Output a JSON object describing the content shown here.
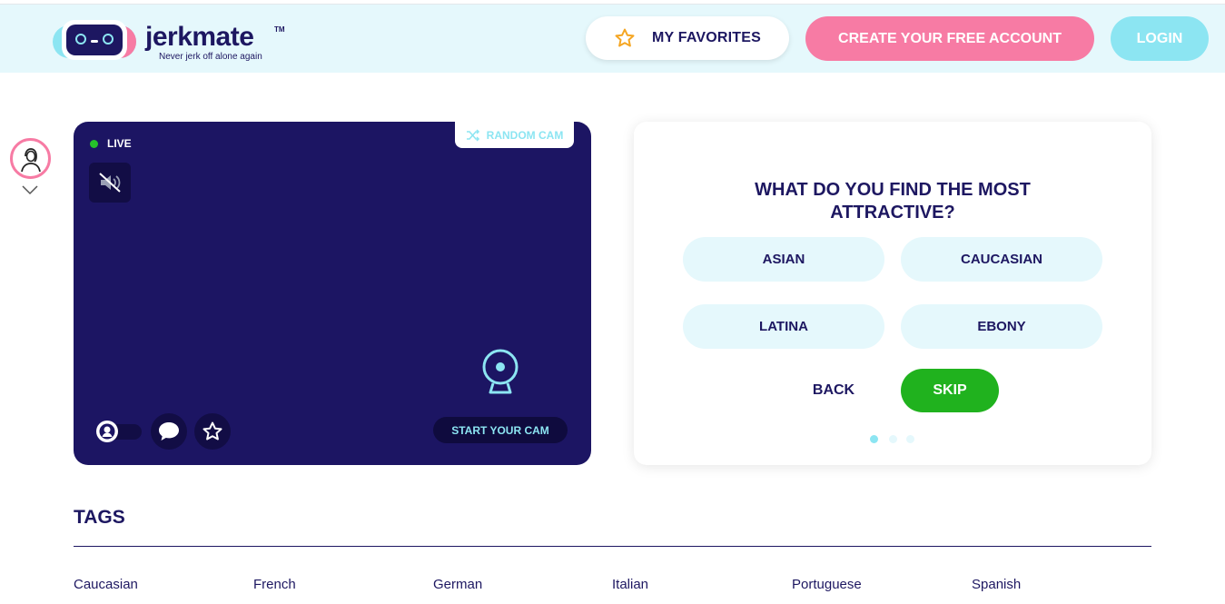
{
  "header": {
    "logo_text": "jerkmate",
    "logo_tm": "TM",
    "logo_tagline": "Never jerk off alone again",
    "favorites_label": "MY FAVORITES",
    "create_account_label": "CREATE YOUR FREE ACCOUNT",
    "login_label": "LOGIN"
  },
  "video": {
    "live_label": "LIVE",
    "random_cam_label": "RANDOM CAM",
    "start_cam_label": "START YOUR CAM"
  },
  "quiz": {
    "question": "WHAT DO YOU FIND THE MOST ATTRACTIVE?",
    "options": [
      "ASIAN",
      "CAUCASIAN",
      "LATINA",
      "EBONY"
    ],
    "back_label": "BACK",
    "skip_label": "SKIP",
    "steps_total": 3,
    "current_step": 1
  },
  "tags": {
    "title": "TAGS",
    "items": [
      "Caucasian",
      "French",
      "German",
      "Italian",
      "Portuguese",
      "Spanish"
    ]
  },
  "colors": {
    "brand_navy": "#1d1761",
    "pink": "#f77ba4",
    "cyan": "#8ce5f2",
    "green": "#20b21e",
    "header_bg": "#e5f8fc"
  },
  "icons": {
    "logo": "robot-logo-icon",
    "favorites": "star-outline-icon",
    "avatar": "user-avatar-icon",
    "mute": "speaker-muted-icon",
    "random": "shuffle-icon",
    "webcam": "webcam-icon",
    "chat": "chat-bubble-icon",
    "favorite_cam": "star-icon"
  }
}
